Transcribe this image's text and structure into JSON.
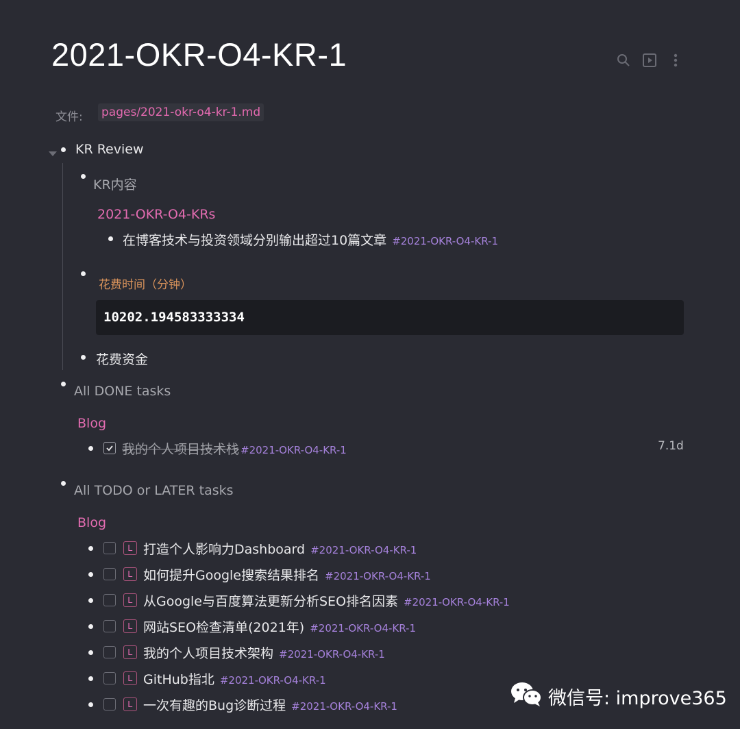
{
  "page": {
    "title": "2021-OKR-O4-KR-1",
    "file_label": "文件:",
    "file_path": "pages/2021-okr-o4-kr-1.md"
  },
  "toolbar": {
    "search_icon": "search-icon",
    "presentation_icon": "presentation-icon",
    "more_icon": "more-vertical-icon"
  },
  "blocks": {
    "kr_review": "KR Review",
    "kr_content": "KR内容",
    "krs_link": "2021-OKR-O4-KRs",
    "kr_item": {
      "text": "在博客技术与投资领域分别输出超过10篇文章",
      "tag": "#2021-OKR-O4-KR-1"
    },
    "time_spent_label": "花费时间（分钟）",
    "time_spent_value": "10202.194583333334",
    "money_spent": "花费资金",
    "done_tasks": "All DONE tasks",
    "done_group": "Blog",
    "done_item": {
      "text": "我的个人项目技术栈",
      "tag": "#2021-OKR-O4-KR-1",
      "duration": "7.1d"
    },
    "todo_tasks": "All TODO or LATER tasks",
    "todo_group": "Blog",
    "todo_marker": "L",
    "todo_items": [
      {
        "text": "打造个人影响力Dashboard",
        "tag": "#2021-OKR-O4-KR-1"
      },
      {
        "text": "如何提升Google搜索结果排名",
        "tag": "#2021-OKR-O4-KR-1"
      },
      {
        "text": "从Google与百度算法更新分析SEO排名因素",
        "tag": "#2021-OKR-O4-KR-1"
      },
      {
        "text": "网站SEO检查清单(2021年)",
        "tag": "#2021-OKR-O4-KR-1"
      },
      {
        "text": "我的个人项目技术架构",
        "tag": "#2021-OKR-O4-KR-1"
      },
      {
        "text": "GitHub指北",
        "tag": "#2021-OKR-O4-KR-1"
      },
      {
        "text": "一次有趣的Bug诊断过程",
        "tag": "#2021-OKR-O4-KR-1"
      }
    ]
  },
  "watermark": {
    "icon": "wechat-icon",
    "text": "微信号: improve365"
  },
  "colors": {
    "background": "#2a2b33",
    "accent_pink": "#e36cb1",
    "tag_purple": "#a682dc",
    "orange": "#d9935b"
  }
}
